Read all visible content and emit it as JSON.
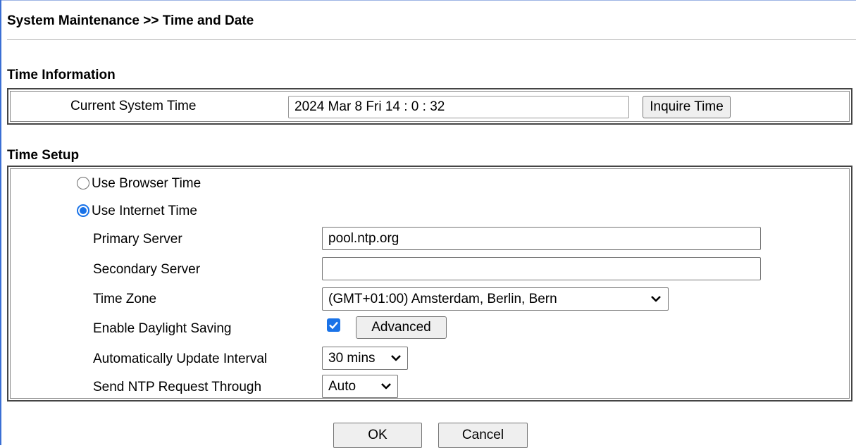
{
  "page": {
    "title": "System Maintenance >> Time and Date"
  },
  "time_information": {
    "heading": "Time Information",
    "current_system_time_label": "Current System Time",
    "current_system_time_value": "2024 Mar 8 Fri 14 : 0 : 32",
    "inquire_button": "Inquire Time"
  },
  "time_setup": {
    "heading": "Time Setup",
    "browser_time_label": "Use Browser Time",
    "browser_time_selected": false,
    "internet_time_label": "Use Internet Time",
    "internet_time_selected": true,
    "primary_server_label": "Primary Server",
    "primary_server_value": "pool.ntp.org",
    "secondary_server_label": "Secondary Server",
    "secondary_server_value": "",
    "time_zone_label": "Time Zone",
    "time_zone_value": "(GMT+01:00) Amsterdam, Berlin, Bern",
    "daylight_saving_label": "Enable Daylight Saving",
    "daylight_saving_checked": true,
    "advanced_button": "Advanced",
    "update_interval_label": "Automatically Update Interval",
    "update_interval_value": "30 mins",
    "ntp_request_label": "Send NTP Request Through",
    "ntp_request_value": "Auto"
  },
  "actions": {
    "ok_button": "OK",
    "cancel_button": "Cancel"
  },
  "colors": {
    "accent": "#1a73e8",
    "panel_border": "#444444",
    "button_bg": "#efefef"
  }
}
